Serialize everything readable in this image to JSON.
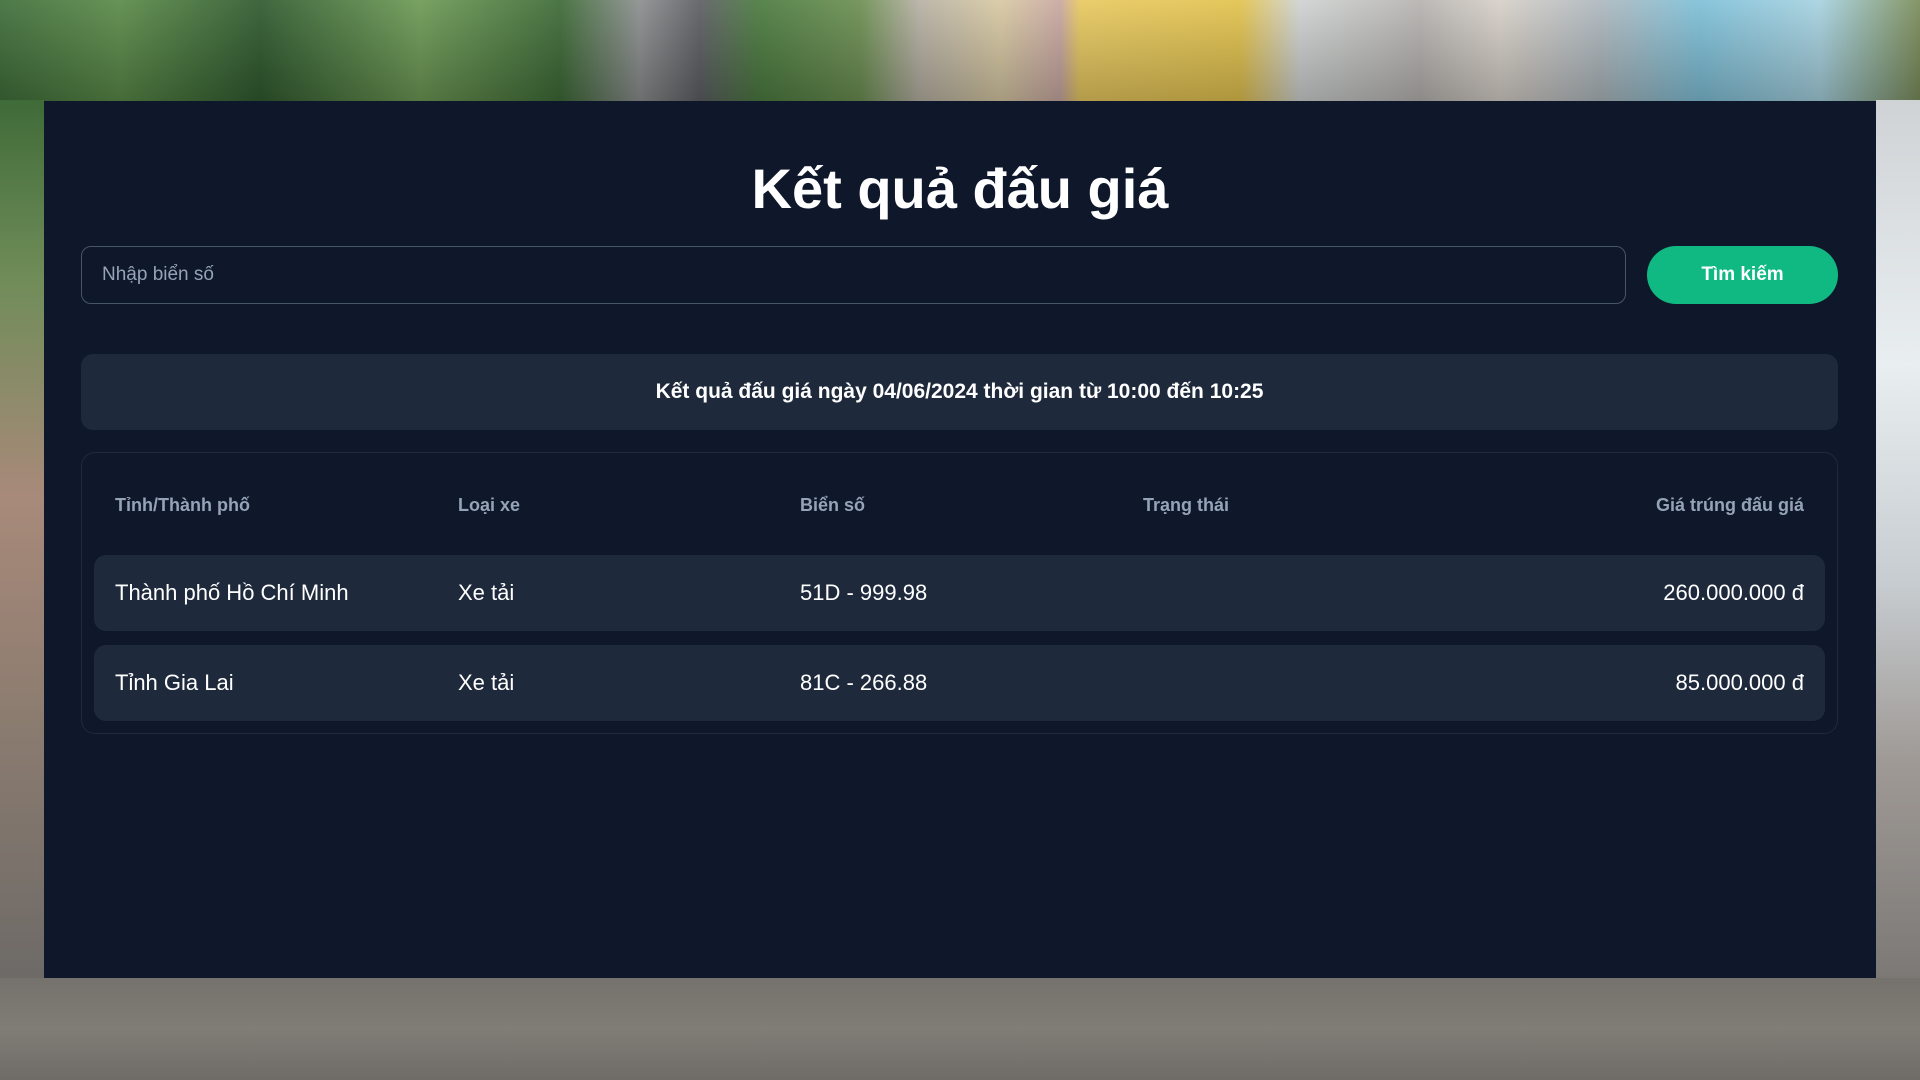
{
  "page": {
    "title": "Kết quả đấu giá"
  },
  "search": {
    "placeholder": "Nhập biển số",
    "value": "",
    "button_label": "Tìm kiếm"
  },
  "session": {
    "text": "Kết quả đấu giá ngày 04/06/2024 thời gian từ 10:00 đến 10:25"
  },
  "table": {
    "headers": [
      "Tỉnh/Thành phố",
      "Loại xe",
      "Biển số",
      "Trạng thái",
      "Giá trúng đấu giá"
    ],
    "rows": [
      {
        "province": "Thành phố Hồ Chí Minh",
        "vehicle_type": "Xe tải",
        "plate": "51D - 999.98",
        "status": "",
        "price": "260.000.000 đ"
      },
      {
        "province": "Tỉnh Gia Lai",
        "vehicle_type": "Xe tải",
        "plate": "81C - 266.88",
        "status": "",
        "price": "85.000.000 đ"
      }
    ]
  },
  "colors": {
    "panel_bg": "#0f172a",
    "card_bg": "#1e293b",
    "accent": "#10b981",
    "muted_text": "#94a3b8",
    "text": "#ffffff"
  }
}
